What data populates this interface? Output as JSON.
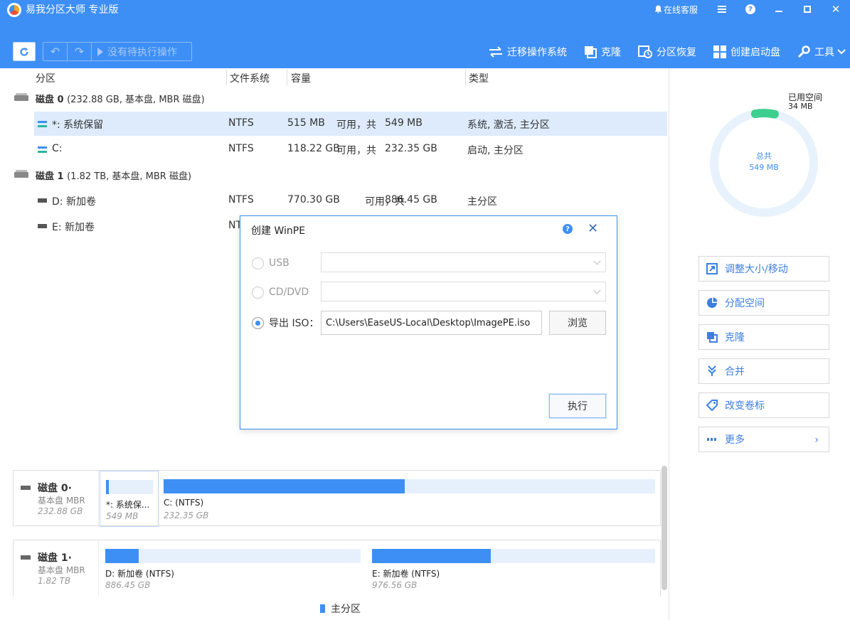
{
  "app": {
    "title": "易我分区大师 专业版",
    "support_label": "在线客服"
  },
  "toolbar": {
    "pending_label": "没有待执行操作",
    "actions": [
      {
        "label": "迁移操作系统",
        "icon": "migrate-icon"
      },
      {
        "label": "克隆",
        "icon": "clone-icon"
      },
      {
        "label": "分区恢复",
        "icon": "recover-icon"
      },
      {
        "label": "创建启动盘",
        "icon": "windows-icon"
      },
      {
        "label": "工具",
        "icon": "wrench-icon"
      }
    ]
  },
  "list": {
    "headers": {
      "partition": "分区",
      "filesystem": "文件系统",
      "capacity": "容量",
      "type": "类型"
    },
    "disks": [
      {
        "name": "磁盘 0",
        "info": "(232.88 GB, 基本盘, MBR 磁盘)",
        "partitions": [
          {
            "name": "*: 系统保留",
            "fs": "NTFS",
            "free": "515 MB",
            "mid": "可用，共",
            "total": "549 MB",
            "type": "系统, 激活, 主分区"
          },
          {
            "name": "C:",
            "fs": "NTFS",
            "free": "118.22 GB",
            "mid": "可用，共",
            "total": "232.35 GB",
            "type": "启动, 主分区"
          }
        ]
      },
      {
        "name": "磁盘 1",
        "info": "(1.82 TB, 基本盘, MBR 磁盘)",
        "partitions": [
          {
            "name": "D: 新加卷",
            "fs": "NTFS",
            "free": "770.30 GB",
            "mid": "可用，共",
            "total": "886.45 GB",
            "type": "主分区"
          },
          {
            "name": "E: 新加卷",
            "fs": "NT",
            "free": "",
            "mid": "",
            "total": "",
            "type": ""
          }
        ]
      }
    ]
  },
  "map": {
    "disks": [
      {
        "name": "磁盘 0·",
        "type": "基本盘 MBR",
        "size": "232.88 GB",
        "segments": [
          {
            "name": "*: 系统保...",
            "size": "549 MB",
            "used_fraction": 0.06
          },
          {
            "name": "C:  (NTFS)",
            "size": "232.35 GB",
            "used_fraction": 0.49
          }
        ]
      },
      {
        "name": "磁盘 1·",
        "type": "基本盘 MBR",
        "size": "1.82 TB",
        "segments": [
          {
            "name": "D: 新加卷 (NTFS)",
            "size": "886.45 GB",
            "used_fraction": 0.13
          },
          {
            "name": "E: 新加卷 (NTFS)",
            "size": "976.56 GB",
            "used_fraction": 0.42
          }
        ]
      }
    ],
    "legend_primary": "主分区"
  },
  "summary": {
    "used_label": "已用空间",
    "used_value": "34 MB",
    "total_label": "总共",
    "total_value": "549 MB",
    "used_fraction": 0.062,
    "color_used": "#3ecf8e",
    "color_free": "#e8f2fd"
  },
  "operations": [
    {
      "label": "调整大小/移动",
      "icon": "resize-icon"
    },
    {
      "label": "分配空间",
      "icon": "pie-icon"
    },
    {
      "label": "克隆",
      "icon": "clone-icon"
    },
    {
      "label": "合并",
      "icon": "merge-icon"
    },
    {
      "label": "改变卷标",
      "icon": "tag-icon"
    },
    {
      "label": "更多",
      "icon": "more-icon"
    }
  ],
  "dialog": {
    "title": "创建 WinPE",
    "usb_label": "USB",
    "cd_label": "CD/DVD",
    "iso_label": "导出 ISO：",
    "iso_path": "C:\\Users\\EaseUS-Local\\Desktop\\ImagePE.iso",
    "browse_label": "浏览",
    "execute_label": "执行",
    "help": "?",
    "close": "✕"
  },
  "colors": {
    "accent": "#3d8ff5",
    "selected_row": "#ddebfc"
  }
}
